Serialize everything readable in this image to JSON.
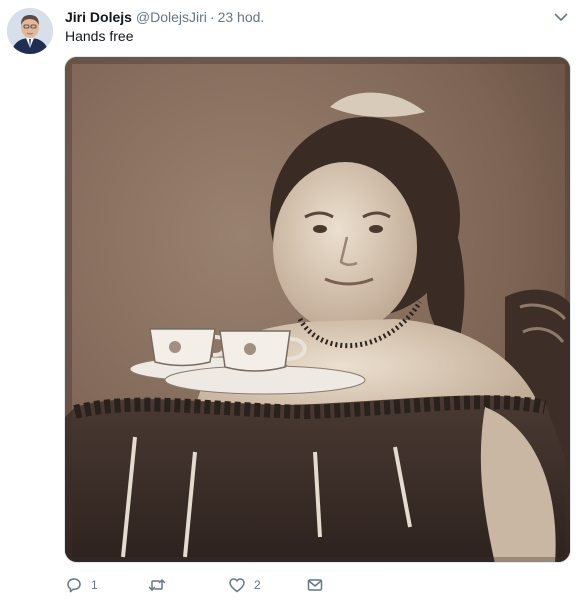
{
  "author": {
    "name": "Jiri Dolejs",
    "handle": "@DolejsJiri",
    "separator": "·",
    "time": "23 hod."
  },
  "tweet": {
    "text": "Hands free"
  },
  "actions": {
    "reply_count": "1",
    "retweet_count": "",
    "like_count": "2"
  },
  "icons": {
    "caret": "chevron-down-icon",
    "reply": "reply-icon",
    "retweet": "retweet-icon",
    "like": "heart-icon",
    "message": "envelope-icon"
  },
  "colors": {
    "text_primary": "#14171a",
    "text_secondary": "#657786",
    "photo_sepia": "#7a6352"
  }
}
